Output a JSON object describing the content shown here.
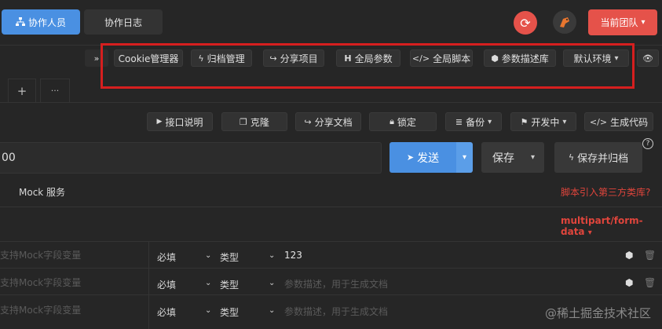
{
  "header": {
    "tab_members": "协作人员",
    "tab_log": "协作日志",
    "current_team": "当前团队"
  },
  "toolbar": {
    "cookie": "Cookie管理器",
    "archive_mgmt": "归档管理",
    "share_project": "分享项目",
    "global_params": "全局参数",
    "global_script": "全局脚本",
    "param_desc_lib": "参数描述库",
    "default_env": "默认环境"
  },
  "tabs_row": {
    "add": "+",
    "more": "···"
  },
  "api_actions": {
    "doc": "接口说明",
    "clone": "克隆",
    "share_doc": "分享文档",
    "lock": "锁定",
    "backup": "备份",
    "status": "开发中",
    "gen_code": "生成代码"
  },
  "request": {
    "url_value": "00",
    "send": "发送",
    "save": "保存",
    "save_archive": "保存并归档"
  },
  "mock": {
    "label": "Mock 服务",
    "script_link": "脚本引入第三方类库?"
  },
  "body": {
    "content_type": "multipart/form-data"
  },
  "params": [
    {
      "name_placeholder": "支持Mock字段变量",
      "required": "必填",
      "type": "类型",
      "desc": "123",
      "desc_is_placeholder": false
    },
    {
      "name_placeholder": "支持Mock字段变量",
      "required": "必填",
      "type": "类型",
      "desc": "参数描述，用于生成文档",
      "desc_is_placeholder": true
    },
    {
      "name_placeholder": "支持Mock字段变量",
      "required": "必填",
      "type": "类型",
      "desc": "参数描述，用于生成文档",
      "desc_is_placeholder": true
    }
  ],
  "watermark": "@稀土掘金技术社区",
  "colors": {
    "primary": "#4a90e2",
    "danger": "#e5524a",
    "link_red": "#e0453c"
  }
}
